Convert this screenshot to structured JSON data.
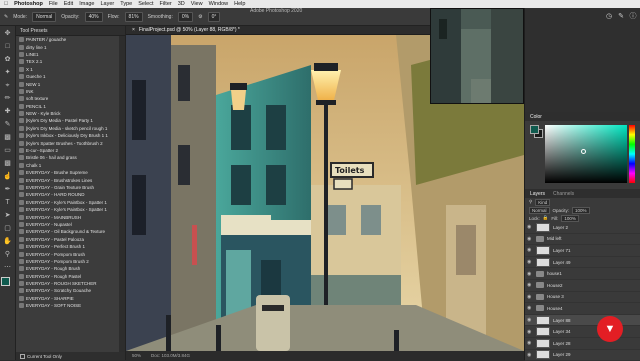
{
  "menubar": {
    "app": "Photoshop",
    "items": [
      "File",
      "Edit",
      "Image",
      "Layer",
      "Type",
      "Select",
      "Filter",
      "3D",
      "View",
      "Window",
      "Help"
    ],
    "window_title": "Adobe Photoshop 2020"
  },
  "options": {
    "mode_label": "Mode:",
    "mode_value": "Normal",
    "opacity_label": "Opacity:",
    "opacity_value": "40%",
    "flow_label": "Flow:",
    "flow_value": "81%",
    "smoothing_label": "Smoothing:",
    "smoothing_value": "0%",
    "angle_value": "0°"
  },
  "presets": {
    "title": "Tool Presets",
    "items": [
      "PAINTER / gouache",
      "dirty line 1",
      "LINE1",
      "TEX 2.1",
      "X 1",
      "Gueche 1",
      "NEW 1",
      "INK",
      "soft texture",
      "PENCIL 1",
      "NEW - Kyle Brick",
      "[Kyle's Dry Media - Pastel Party 1",
      "[Kyle's Dry Media - sketch pencil rough 1",
      "[Kyle's Inkbox - Deliciously Dry Brush 1 1",
      "[Kyle's Spatter Brushes - Toothbrush 2",
      "E-cur--Spatter 2",
      "Bristle 06 - hail and grass",
      "Chalk 1",
      "EVERYDAY - Brushe Supreme",
      "EVERYDAY - Brushstrokes Lines",
      "EVERYDAY - Grain Texture Brush",
      "EVERYDAY - HARD ROUND",
      "EVERYDAY - Kyle's Paintbox - Spatter 1",
      "EVERYDAY - Kyle's Paintbox - Spatter 1",
      "EVERYDAY - MAINBRUSH",
      "EVERYDAY - Nupastel",
      "EVERYDAY - Oil Background & Texture",
      "EVERYDAY - Pastel Palooza",
      "EVERYDAY - Perfect Brush 1",
      "EVERYDAY - Pompom Brush",
      "EVERYDAY - Pompom Brush 2",
      "EVERYDAY - Rough Brush",
      "EVERYDAY - Rough Pastel",
      "EVERYDAY - ROUGH SKETCHER",
      "EVERYDAY - Scratchy Gouache",
      "EVERYDAY - SHARPIE",
      "EVERYDAY - SOFT NOISE"
    ],
    "footer": "Current Tool Only"
  },
  "document": {
    "tab": "FinalProject.psd @ 50% (Layer 88, RGB/8*) *",
    "sign_text": "Toilets"
  },
  "status": {
    "zoom": "50%",
    "doc": "Doc: 103.0M/3.84G"
  },
  "color_panel": {
    "title": "Color",
    "fg": "#0f5a4e",
    "bg": "#1a1a1a"
  },
  "layers": {
    "tabs": [
      "Layers",
      "Channels"
    ],
    "kind": "Kind",
    "blend": "Normal",
    "opacity_label": "Opacity:",
    "opacity": "100%",
    "lock_label": "Lock:",
    "fill_label": "Fill:",
    "fill": "100%",
    "items": [
      {
        "name": "Layer 2",
        "type": "layer"
      },
      {
        "name": "Mid left",
        "type": "group"
      },
      {
        "name": "Layer 71",
        "type": "layer"
      },
      {
        "name": "Layer 49",
        "type": "layer"
      },
      {
        "name": "house1",
        "type": "group"
      },
      {
        "name": "House2",
        "type": "group"
      },
      {
        "name": "House 3",
        "type": "group"
      },
      {
        "name": "House4",
        "type": "group"
      },
      {
        "name": "Layer 88",
        "type": "layer",
        "selected": true
      },
      {
        "name": "Layer 34",
        "type": "layer"
      },
      {
        "name": "Layer 28",
        "type": "layer"
      },
      {
        "name": "Layer 29",
        "type": "layer"
      }
    ]
  }
}
